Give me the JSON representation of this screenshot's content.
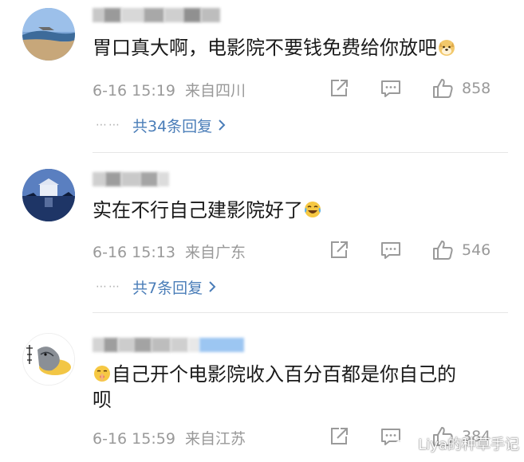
{
  "comments": [
    {
      "text": "胃口真大啊，电影院不要钱免费给你放吧",
      "emoji": "doge-face-icon",
      "time": "6-16 15:19",
      "location": "来自四川",
      "likes": "858",
      "replies_label": "共34条回复",
      "replies_dots": "⋯⋯"
    },
    {
      "text": "实在不行自己建影院好了",
      "emoji": "laugh-crying-face-icon",
      "time": "6-16 15:13",
      "location": "来自广东",
      "likes": "546",
      "replies_label": "共7条回复",
      "replies_dots": "⋯⋯"
    },
    {
      "text_line1": "自己开个电影院收入百分百都是你自己的",
      "text_line2": "呗",
      "emoji": "shush-face-icon",
      "time": "6-16 15:59",
      "location": "来自江苏",
      "likes": "384"
    }
  ],
  "watermark": "Liya的种草手记",
  "colors": {
    "meta": "#999999",
    "link": "#4a7db8",
    "text": "#1a1a1a"
  }
}
